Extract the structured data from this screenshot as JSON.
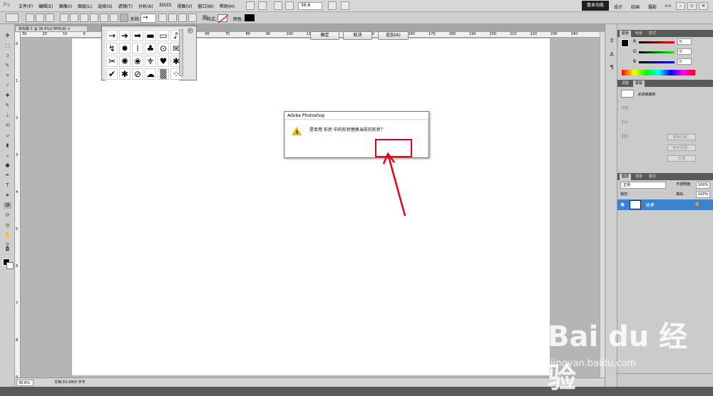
{
  "app": {
    "logo": "Ps",
    "menus": [
      "文件(F)",
      "编辑(E)",
      "图像(I)",
      "图层(L)",
      "选择(S)",
      "滤镜(T)",
      "分析(A)",
      "3D(D)",
      "视图(V)",
      "窗口(W)",
      "帮助(H)"
    ],
    "zoom": "36.6",
    "workspaces": {
      "active": "基本功能",
      "others": [
        "设计",
        "绘画",
        "摄影"
      ],
      "more": ">>"
    }
  },
  "options": {
    "shape_label": "形状:",
    "shape_value": "→",
    "style_label": "样式:",
    "color_label": "颜色:",
    "color": "#000000"
  },
  "document": {
    "tab_title": "未标题-1 @ 36.6%(CMYK/8)",
    "close": "×",
    "ruler_numbers": [
      "30",
      "20",
      "10",
      "0",
      "10",
      "20",
      "30",
      "40",
      "50",
      "60",
      "70",
      "80",
      "90",
      "100",
      "110",
      "120",
      "130",
      "140",
      "150",
      "160",
      "170",
      "180",
      "190",
      "200",
      "210",
      "220",
      "230",
      "240"
    ],
    "vruler_numbers": [
      "0",
      "1",
      "2",
      "3",
      "4",
      "5",
      "6",
      "7",
      "8",
      "9"
    ],
    "status_zoom": "36.6%",
    "status_doc": "文档:33.2M/0 字节"
  },
  "shape_picker": {
    "shapes": [
      "→",
      "➜",
      "➡",
      "▬",
      "▭",
      "♪",
      "↯",
      "✹",
      "⁞",
      "♣",
      "⊙",
      "✉",
      "✂",
      "✺",
      "❀",
      "⚜",
      "♥",
      "✱",
      "✔",
      "✱",
      "⊘",
      "☁",
      "▒",
      "⁘"
    ],
    "menu": "▸"
  },
  "dialog": {
    "title": "Adobe Photoshop",
    "message": "是否用 形状 中的形状替换当前的形状？",
    "icon": "warning-icon",
    "ok": "确定",
    "cancel": "取消",
    "append": "追加(A)"
  },
  "panels": {
    "color_tabs": [
      "颜色",
      "色板",
      "样式"
    ],
    "color": {
      "r": "0",
      "g": "0",
      "b": "0",
      "labels": [
        "R",
        "G",
        "B"
      ]
    },
    "adjust_tabs": [
      "调整",
      "蒙版"
    ],
    "mask": {
      "title": "未选择蒙版",
      "density": "浓度:",
      "feather": "羽化:",
      "refine": "调整:",
      "edge_button": "蒙版边缘...",
      "color_range_button": "颜色范围...",
      "invert_button": "反相"
    },
    "layers_tabs": [
      "图层",
      "通道",
      "路径"
    ],
    "layers": {
      "blend": "正常",
      "opacity_label": "不透明度:",
      "opacity": "100%",
      "lock_label": "锁定:",
      "fill_label": "填充:",
      "fill": "100%",
      "rows": [
        {
          "name": "背景",
          "lock": "🔒"
        }
      ]
    }
  },
  "watermark": {
    "main": "Bai du 经验",
    "sub": "jingyan.baidu.com"
  }
}
